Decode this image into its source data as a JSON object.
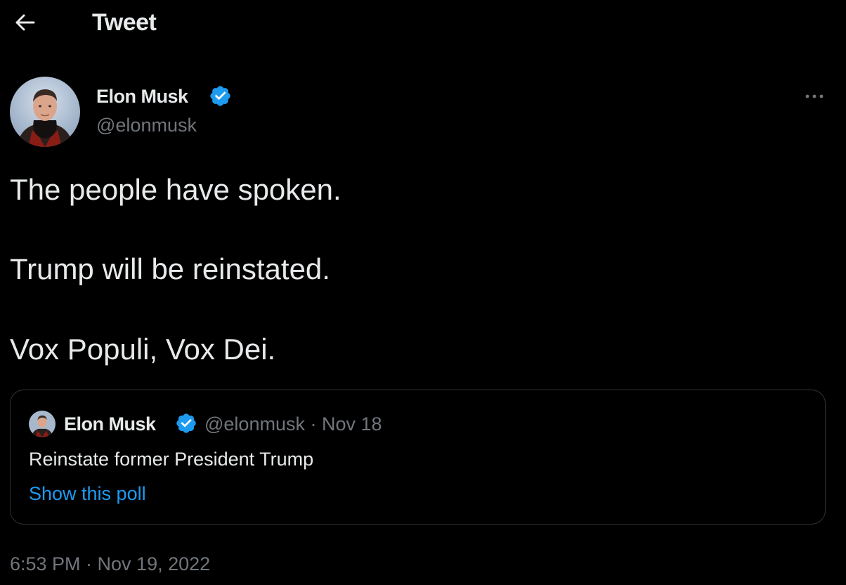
{
  "header": {
    "title": "Tweet",
    "back_icon": "arrow-left-icon"
  },
  "author": {
    "name": "Elon Musk",
    "handle": "@elonmusk",
    "verified_icon": "verified-badge-icon",
    "more_icon": "more-horizontal-icon"
  },
  "tweet": {
    "lines": [
      "The people have spoken.",
      "Trump will be reinstated.",
      "Vox Populi, Vox Dei."
    ]
  },
  "quote": {
    "name": "Elon Musk",
    "meta": "@elonmusk · Nov 18",
    "text": "Reinstate former President Trump",
    "link_label": "Show this poll"
  },
  "timestamp": "6:53 PM · Nov 19, 2022",
  "colors": {
    "background": "#000000",
    "text_primary": "#e7e9ea",
    "text_secondary": "#71767b",
    "accent": "#1d9bf0",
    "border": "#2f3336"
  }
}
